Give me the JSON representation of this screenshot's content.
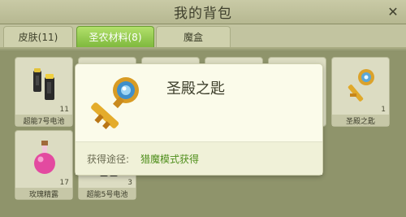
{
  "window": {
    "title": "我的背包",
    "close_icon": "close-icon"
  },
  "tabs": [
    {
      "label": "皮肤(11)",
      "active": false
    },
    {
      "label": "圣农材料(8)",
      "active": true
    },
    {
      "label": "魔盒",
      "active": false
    }
  ],
  "slots": [
    {
      "name": "超能7号电池",
      "count": "11",
      "icon": "battery-icon"
    },
    {
      "name": "",
      "count": "",
      "icon": ""
    },
    {
      "name": "",
      "count": "",
      "icon": ""
    },
    {
      "name": "",
      "count": "",
      "icon": ""
    },
    {
      "name": "",
      "count": "",
      "icon": ""
    },
    {
      "name": "圣殿之匙",
      "count": "1",
      "icon": "key-icon"
    },
    {
      "name": "玫瑰精露",
      "count": "17",
      "icon": "potion-icon"
    },
    {
      "name": "超能5号电池",
      "count": "3",
      "icon": "battery-icon"
    }
  ],
  "tooltip": {
    "item_name": "圣殿之匙",
    "source_label": "获得途径:",
    "source_value": "猎魔模式获得",
    "icon": "key-icon"
  },
  "colors": {
    "active_tab": "#8cc443",
    "source_value": "#4f8f1c",
    "popup_bg": "#fbfbea"
  }
}
